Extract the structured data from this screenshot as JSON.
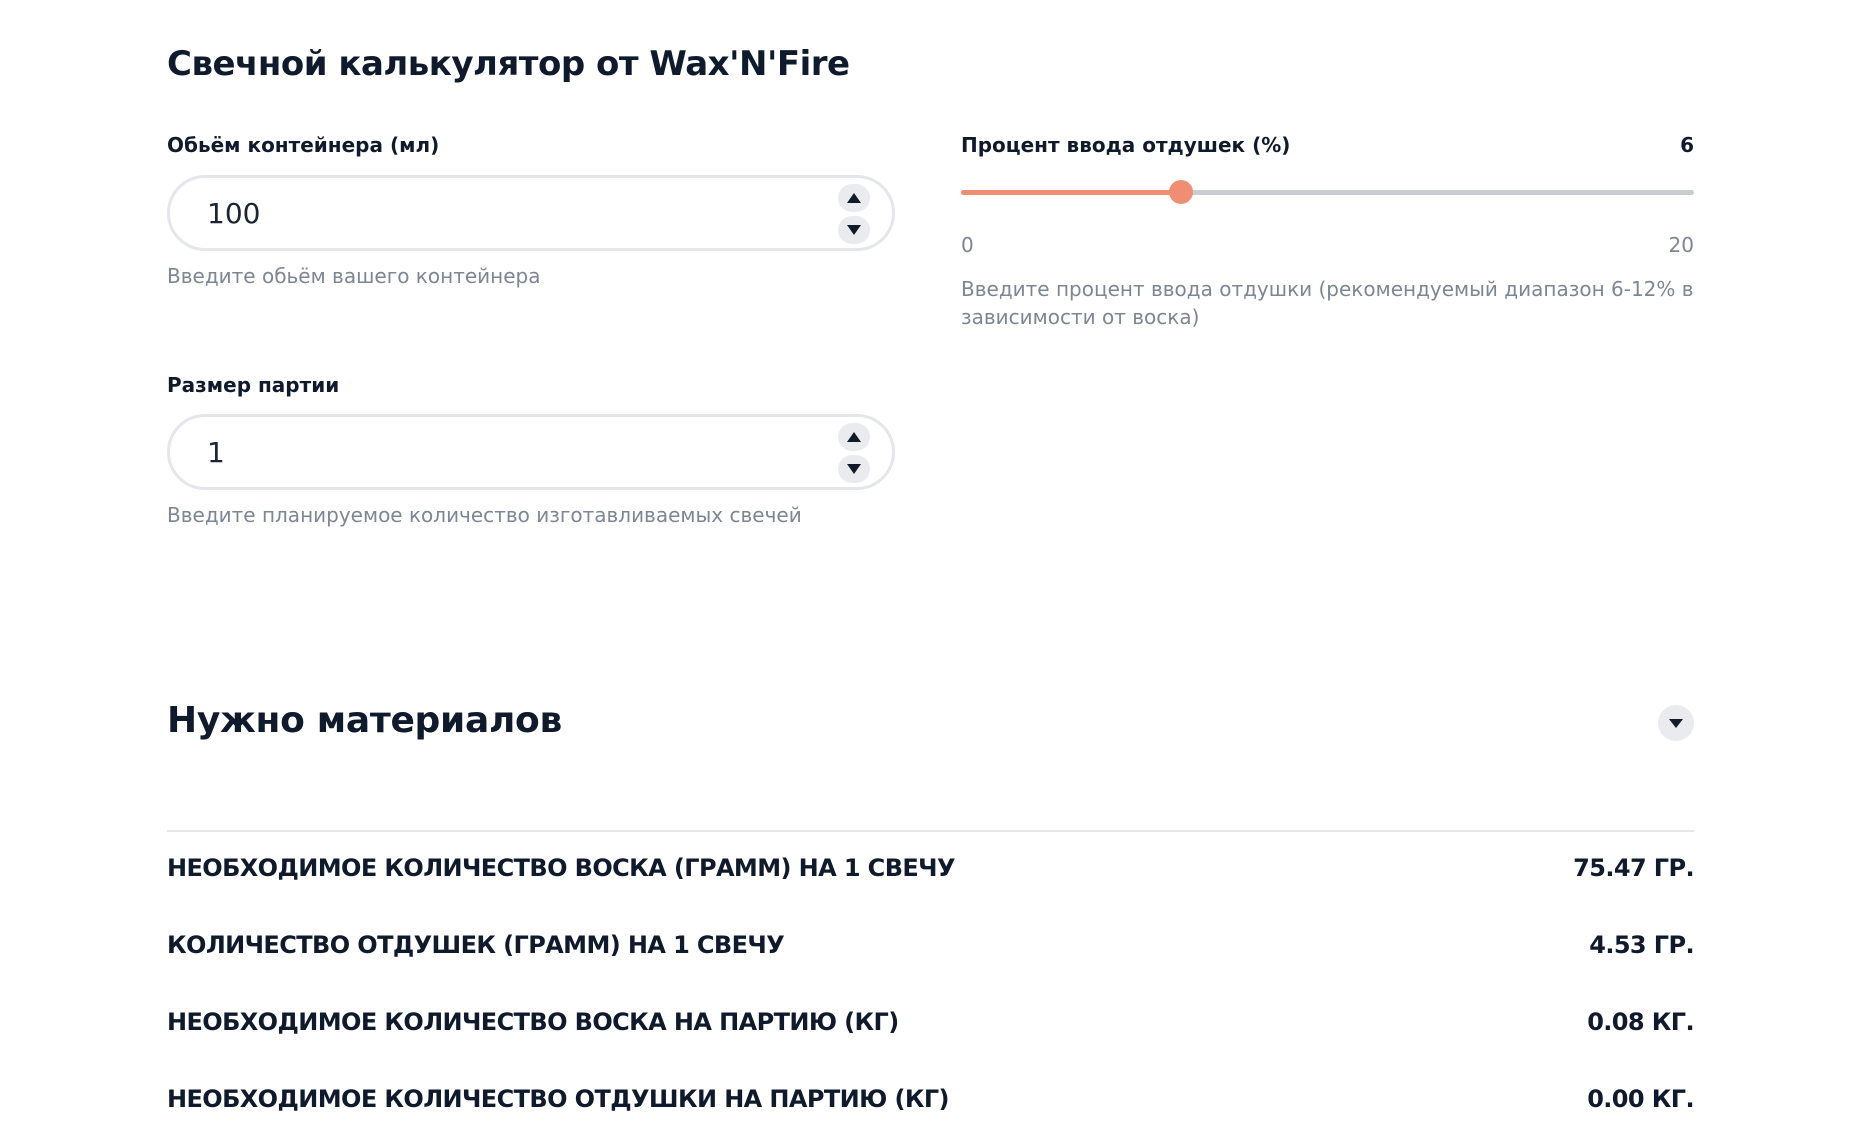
{
  "title": "Свечной калькулятор от Wax'N'Fire",
  "volume": {
    "label": "Обьём контейнера (мл)",
    "value": "100",
    "hint": "Введите обьём вашего контейнера"
  },
  "batch": {
    "label": "Размер партии",
    "value": "1",
    "hint": "Введите планируемое количество изготавливаемых свечей"
  },
  "fragrance": {
    "label": "Процент ввода отдушек (%)",
    "value": "6",
    "min": "0",
    "max": "20",
    "hint": "Введите процент ввода отдушки (рекомендуемый диапазон 6-12% в зависимости от воска)"
  },
  "colors": {
    "accent": "#ef8e73",
    "track": "#c9ccd1",
    "text": "#0f1b2d",
    "muted": "#7c8694"
  },
  "materials": {
    "title": "Нужно материалов",
    "rows": [
      {
        "label": "НЕОБХОДИМОЕ КОЛИЧЕСТВО ВОСКА (ГРАММ) НА 1 СВЕЧУ",
        "value": "75.47 ГР."
      },
      {
        "label": "КОЛИЧЕСТВО ОТДУШЕК (ГРАММ) НА 1 СВЕЧУ",
        "value": "4.53 ГР."
      },
      {
        "label": "НЕОБХОДИМОЕ КОЛИЧЕСТВО ВОСКА НА ПАРТИЮ (КГ)",
        "value": "0.08 КГ."
      },
      {
        "label": "НЕОБХОДИМОЕ КОЛИЧЕСТВО ОТДУШКИ НА ПАРТИЮ (КГ)",
        "value": "0.00 КГ."
      }
    ]
  },
  "icons": {
    "spin_up": "triangle-up-icon",
    "spin_down": "triangle-down-icon",
    "collapse": "chevron-down-icon"
  }
}
